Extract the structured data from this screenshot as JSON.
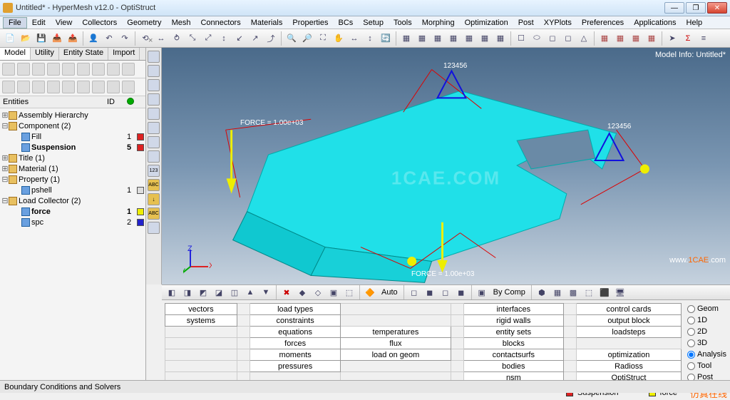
{
  "title": "Untitled* - HyperMesh v12.0 - OptiStruct",
  "menu": [
    "File",
    "Edit",
    "View",
    "Collectors",
    "Geometry",
    "Mesh",
    "Connectors",
    "Materials",
    "Properties",
    "BCs",
    "Setup",
    "Tools",
    "Morphing",
    "Optimization",
    "Post",
    "XYPlots",
    "Preferences",
    "Applications",
    "Help"
  ],
  "pane_tabs": [
    "Model",
    "Utility",
    "Entity State",
    "Import"
  ],
  "tree_header": {
    "entities": "Entities",
    "id": "ID"
  },
  "tree": {
    "assembly": {
      "label": "Assembly Hierarchy"
    },
    "component": {
      "label": "Component (2)"
    },
    "fill": {
      "label": "Fill",
      "id": "1",
      "color": "#d22"
    },
    "suspension": {
      "label": "Suspension",
      "id": "5",
      "color": "#d22",
      "bold": true
    },
    "title": {
      "label": "Title (1)"
    },
    "material": {
      "label": "Material (1)"
    },
    "property": {
      "label": "Property (1)"
    },
    "pshell": {
      "label": "pshell",
      "id": "1",
      "color": "#ddd"
    },
    "loadcol": {
      "label": "Load Collector (2)"
    },
    "force": {
      "label": "force",
      "id": "1",
      "color": "#ee0",
      "bold": true
    },
    "spc": {
      "label": "spc",
      "id": "2",
      "color": "#22c"
    }
  },
  "model_info": "Model Info: Untitled*",
  "forces": {
    "f1": "FORCE = 1.00e+03",
    "f2": "FORCE = 1.00e+03"
  },
  "spc": {
    "s1": "123456",
    "s2": "123456"
  },
  "watermark": {
    "main": "1CAE.COM",
    "site1": "www.",
    "site2": "1CAE",
    "site3": ".com",
    "cn": "仿真在线"
  },
  "cmd_rows": [
    [
      "vectors",
      "",
      "load types",
      "",
      "",
      "interfaces",
      "",
      "control cards"
    ],
    [
      "systems",
      "",
      "constraints",
      "",
      "",
      "rigid walls",
      "",
      "output block"
    ],
    [
      "",
      "",
      "equations",
      "temperatures",
      "",
      "entity sets",
      "",
      "loadsteps"
    ],
    [
      "",
      "",
      "forces",
      "flux",
      "",
      "blocks",
      "",
      ""
    ],
    [
      "",
      "",
      "moments",
      "load on geom",
      "",
      "contactsurfs",
      "",
      "optimization"
    ],
    [
      "",
      "",
      "pressures",
      "",
      "",
      "bodies",
      "",
      "Radioss"
    ],
    [
      "",
      "",
      "",
      "",
      "",
      "nsm",
      "",
      "OptiStruct"
    ]
  ],
  "radio": [
    "Geom",
    "1D",
    "2D",
    "3D",
    "Analysis",
    "Tool",
    "Post"
  ],
  "radio_sel": 4,
  "status_strip": {
    "suspension": "Suspension",
    "force": "force"
  },
  "statusbar": "Boundary Conditions and Solvers",
  "auto_label": "Auto",
  "bycomp_label": "By Comp"
}
